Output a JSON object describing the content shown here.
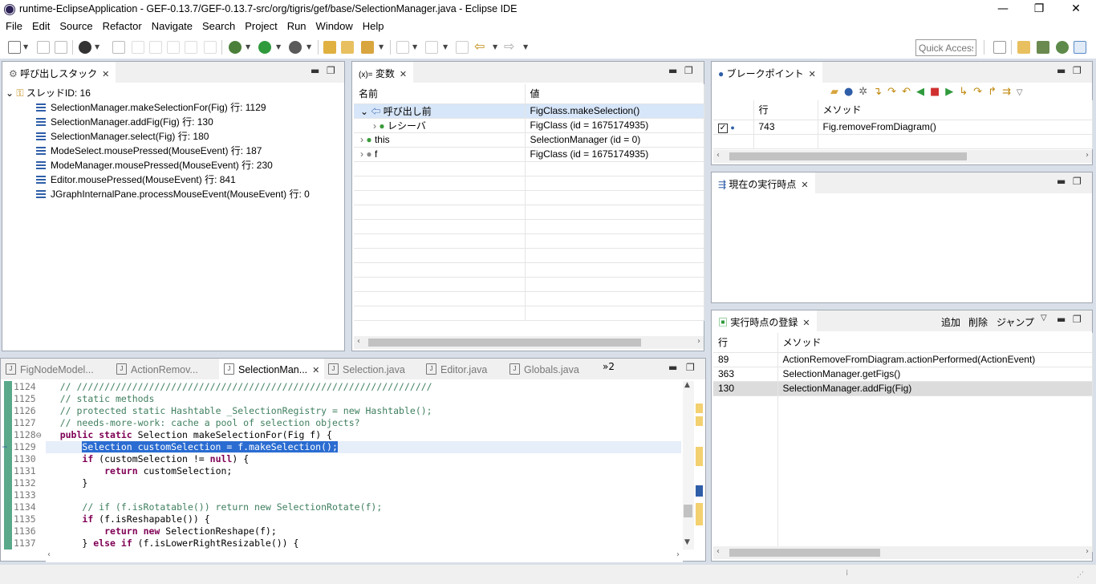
{
  "window": {
    "title": "runtime-EclipseApplication - GEF-0.13.7/GEF-0.13.7-src/org/tigris/gef/base/SelectionManager.java - Eclipse IDE",
    "minimize": "—",
    "restore": "❐",
    "close": "✕"
  },
  "menu": [
    "File",
    "Edit",
    "Source",
    "Refactor",
    "Navigate",
    "Search",
    "Project",
    "Run",
    "Window",
    "Help"
  ],
  "toolbar": {
    "quick_access": "Quick Access"
  },
  "callstack": {
    "tab": "呼び出しスタック",
    "thread": "スレッドID: 16",
    "frames": [
      "SelectionManager.makeSelectionFor(Fig) 行: 1129",
      "SelectionManager.addFig(Fig) 行: 130",
      "SelectionManager.select(Fig) 行: 180",
      "ModeSelect.mousePressed(MouseEvent) 行: 187",
      "ModeManager.mousePressed(MouseEvent) 行: 230",
      "Editor.mousePressed(MouseEvent) 行: 841",
      "JGraphInternalPane.processMouseEvent(MouseEvent) 行: 0"
    ]
  },
  "variables": {
    "tab_prefix": "(x)=",
    "tab": "変数",
    "col_name": "名前",
    "col_value": "値",
    "rows": [
      {
        "name": "呼び出し前",
        "value": "FigClass.makeSelection()"
      },
      {
        "name": "レシーバ",
        "value": "FigClass (id = 1675174935)"
      },
      {
        "name": "this",
        "value": "SelectionManager (id = 0)"
      },
      {
        "name": "f",
        "value": "FigClass (id = 1675174935)"
      }
    ]
  },
  "breakpoints": {
    "tab": "ブレークポイント",
    "col_line": "行",
    "col_method": "メソッド",
    "rows": [
      {
        "line": "743",
        "method": "Fig.removeFromDiagram()"
      }
    ]
  },
  "current": {
    "tab": "現在の実行時点"
  },
  "registry": {
    "tab": "実行時点の登録",
    "actions": {
      "add": "追加",
      "delete": "削除",
      "jump": "ジャンプ"
    },
    "col_line": "行",
    "col_method": "メソッド",
    "rows": [
      {
        "line": "89",
        "method": "ActionRemoveFromDiagram.actionPerformed(ActionEvent)"
      },
      {
        "line": "363",
        "method": "SelectionManager.getFigs()"
      },
      {
        "line": "130",
        "method": "SelectionManager.addFig(Fig)"
      }
    ]
  },
  "editor": {
    "tabs": [
      "FigNodeModel...",
      "ActionRemov...",
      "SelectionMan...",
      "Selection.java",
      "Editor.java",
      "Globals.java"
    ],
    "overflow": "»2",
    "lines": [
      {
        "n": "1124",
        "html": "    <span class='cm'>// ////////////////////////////////////////////////////////////////</span>"
      },
      {
        "n": "1125",
        "html": "    <span class='cm'>// static methods</span>"
      },
      {
        "n": "1126",
        "html": "    <span class='cm'>// protected static Hashtable _SelectionRegistry = new Hashtable();</span>"
      },
      {
        "n": "1127",
        "html": "    <span class='cm'>// needs-more-work: cache a pool of selection objects?</span>"
      },
      {
        "n": "1128",
        "html": "    <span class='kw'>public</span> <span class='kw'>static</span> Selection makeSelectionFor(Fig f) {"
      },
      {
        "n": "1129",
        "html": "        Selection customSelection = f.makeSelection();"
      },
      {
        "n": "1130",
        "html": "        <span class='kw'>if</span> (customSelection != <span class='kw'>null</span>) {"
      },
      {
        "n": "1131",
        "html": "            <span class='kw'>return</span> customSelection;"
      },
      {
        "n": "1132",
        "html": "        }"
      },
      {
        "n": "1133",
        "html": ""
      },
      {
        "n": "1134",
        "html": "        <span class='cm'>// if (f.isRotatable()) return new SelectionRotate(f);</span>"
      },
      {
        "n": "1135",
        "html": "        <span class='kw'>if</span> (f.isReshapable()) {"
      },
      {
        "n": "1136",
        "html": "            <span class='kw'>return</span> <span class='kw'>new</span> SelectionReshape(f);"
      },
      {
        "n": "1137",
        "html": "        } <span class='kw'>else</span> <span class='kw'>if</span> (f.isLowerRightResizable()) {"
      }
    ]
  },
  "colors": {
    "accent": "#2a6cd1",
    "keyword": "#7f0055",
    "comment": "#3f7f5f"
  }
}
